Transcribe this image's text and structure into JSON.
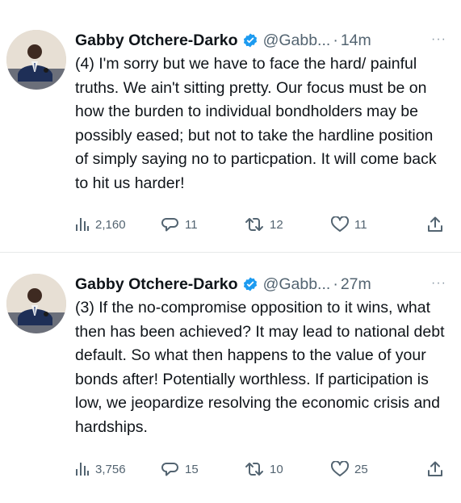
{
  "tweets": [
    {
      "author": "Gabby Otchere-Darko",
      "handle": "@Gabb...",
      "separator": "·",
      "time": "14m",
      "text": "(4) I'm sorry but we have to face the hard/ painful truths. We ain't sitting pretty. Our focus must be on how the burden to individual bondholders may be possibly eased; but not to take the hardline position of simply saying no to particpation. It will come back to hit us harder!",
      "views": "2,160",
      "replies": "11",
      "retweets": "12",
      "likes": "11",
      "more": "···"
    },
    {
      "author": "Gabby Otchere-Darko",
      "handle": "@Gabb...",
      "separator": "·",
      "time": "27m",
      "text": "(3) If the no-compromise opposition to it wins, what then has been achieved? It may lead to national debt default. So what then happens to the value of your bonds after! Potentially worthless. If participation is low, we jeopardize resolving the economic crisis and hardships.",
      "views": "3,756",
      "replies": "15",
      "retweets": "10",
      "likes": "25",
      "more": "···"
    }
  ],
  "colors": {
    "text": "#0f1419",
    "secondary": "#536471",
    "verified": "#1d9bf0",
    "divider": "#e7e9ea"
  },
  "icons": [
    "verified-badge-icon",
    "views-icon",
    "reply-icon",
    "retweet-icon",
    "like-icon",
    "share-icon",
    "more-icon"
  ]
}
